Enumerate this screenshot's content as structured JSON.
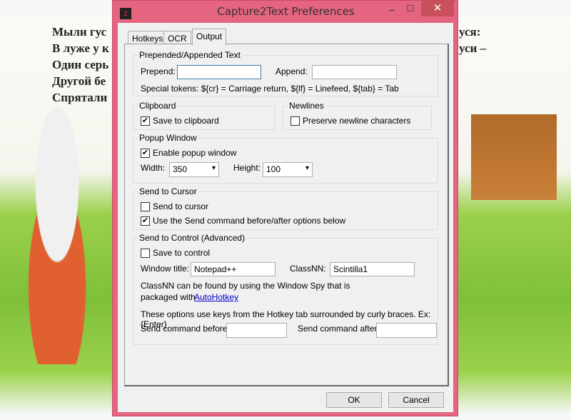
{
  "background": {
    "poem_left": [
      "Мыли гус",
      "В луже у к",
      "Один серь",
      "Другой бе",
      "Спрятали"
    ],
    "poem_right": [
      "уся:",
      "уси –"
    ]
  },
  "window": {
    "title": "Capture2Text Preferences",
    "minimize": "‒",
    "maximize": "☐",
    "close": "✕",
    "icon_text": "2"
  },
  "tabs": [
    {
      "label": "Hotkeys",
      "active": false
    },
    {
      "label": "OCR",
      "active": false
    },
    {
      "label": "Output",
      "active": true
    }
  ],
  "prepend_group": {
    "label": "Prepended/Appended Text",
    "prepend_label": "Prepend:",
    "prepend_value": "",
    "append_label": "Append:",
    "append_value": "",
    "tokens": "Special tokens:  ${cr} = Carriage return,  ${lf} = Linefeed,  ${tab} = Tab"
  },
  "clipboard": {
    "label": "Clipboard",
    "save": {
      "label": "Save to clipboard",
      "checked": true
    }
  },
  "newlines": {
    "label": "Newlines",
    "preserve": {
      "label": "Preserve newline characters",
      "checked": false
    }
  },
  "popup": {
    "label": "Popup Window",
    "enable": {
      "label": "Enable popup window",
      "checked": true
    },
    "width_label": "Width:",
    "width_value": "350",
    "height_label": "Height:",
    "height_value": "100"
  },
  "cursor": {
    "label": "Send to Cursor",
    "send": {
      "label": "Send to cursor",
      "checked": false
    },
    "use_send": {
      "label": "Use the Send command before/after options below",
      "checked": true
    }
  },
  "control": {
    "label": "Send to Control (Advanced)",
    "save": {
      "label": "Save to control",
      "checked": false
    },
    "window_title_label": "Window title:",
    "window_title_value": "Notepad++",
    "classnn_label": "ClassNN:",
    "classnn_value": "Scintilla1",
    "help1": "ClassNN can be found by using the Window Spy that is",
    "help2": "packaged with",
    "link": "AutoHotkey",
    "options_note": "These options use keys from the Hotkey tab surrounded by curly braces. Ex: {Enter}",
    "before_label": "Send command before:",
    "before_value": "",
    "after_label": "Send command after:",
    "after_value": ""
  },
  "buttons": {
    "ok": "OK",
    "cancel": "Cancel"
  },
  "colors": {
    "titlebar": "#e5647f",
    "close_button": "#c7505a",
    "dialog_bg": "#f0f0f0",
    "link": "#0000cc"
  }
}
